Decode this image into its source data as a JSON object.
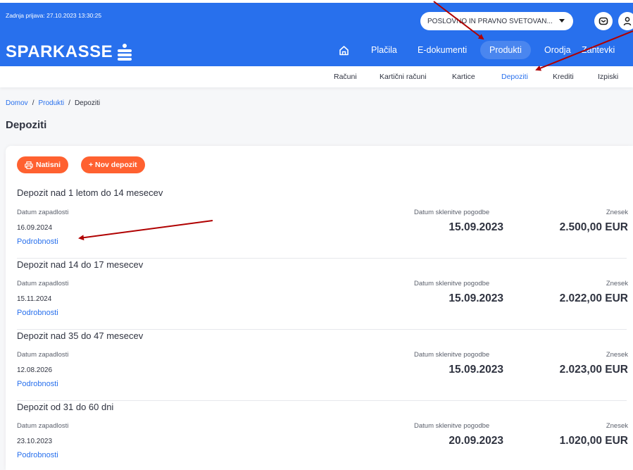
{
  "header": {
    "last_login": "Zadnja prijava: 27.10.2023 13:30:25",
    "context_select_value": "POSLOVNO IN PRAVNO SVETOVAN...",
    "brand": "SPARKASSE",
    "colors": {
      "primary": "#2870ed",
      "accent": "#ff6130",
      "annotation": "#b00000"
    }
  },
  "main_nav": {
    "home_icon": "home-icon",
    "items": [
      "Plačila",
      "E-dokumenti",
      "Produkti",
      "Orodja",
      "Zahtevki"
    ],
    "active": "Produkti"
  },
  "sub_nav": {
    "items": [
      "Računi",
      "Kartični računi",
      "Kartice",
      "Depoziti",
      "Krediti",
      "Izpiski"
    ],
    "active": "Depoziti"
  },
  "breadcrumb": [
    "Domov",
    "Produkti",
    "Depoziti"
  ],
  "page_title": "Depoziti",
  "actions": {
    "print": "Natisni",
    "new_deposit": "+ Nov depozit"
  },
  "deposits": [
    {
      "title": "Depozit nad 1 letom do 14 mesecev",
      "maturity_label": "Datum zapadlosti",
      "maturity_date": "16.09.2024",
      "contract_label": "Datum sklenitve pogodbe",
      "contract_date": "15.09.2023",
      "amount_label": "Znesek",
      "amount": "2.500,00 EUR",
      "details": "Podrobnosti"
    },
    {
      "title": "Depozit nad 14 do 17 mesecev",
      "maturity_label": "Datum zapadlosti",
      "maturity_date": "15.11.2024",
      "contract_label": "Datum sklenitve pogodbe",
      "contract_date": "15.09.2023",
      "amount_label": "Znesek",
      "amount": "2.022,00 EUR",
      "details": "Podrobnosti"
    },
    {
      "title": "Depozit nad 35 do 47 mesecev",
      "maturity_label": "Datum zapadlosti",
      "maturity_date": "12.08.2026",
      "contract_label": "Datum sklenitve pogodbe",
      "contract_date": "15.09.2023",
      "amount_label": "Znesek",
      "amount": "2.023,00 EUR",
      "details": "Podrobnosti"
    },
    {
      "title": "Depozit od 31 do 60 dni",
      "maturity_label": "Datum zapadlosti",
      "maturity_date": "23.10.2023",
      "contract_label": "Datum sklenitve pogodbe",
      "contract_date": "20.09.2023",
      "amount_label": "Znesek",
      "amount": "1.020,00 EUR",
      "details": "Podrobnosti"
    }
  ]
}
